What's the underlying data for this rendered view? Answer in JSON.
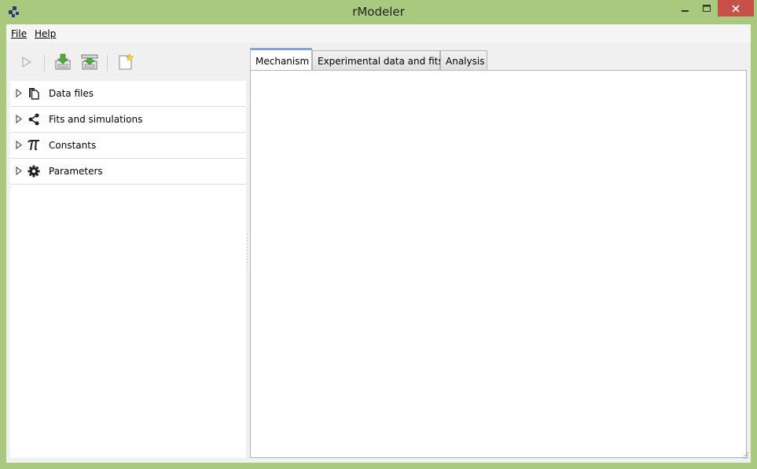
{
  "window": {
    "title": "rModeler",
    "frame_color": "#a8c97e",
    "close_color": "#c7504a"
  },
  "menu": {
    "file": "File",
    "help": "Help"
  },
  "toolbar": {
    "buttons": [
      {
        "icon": "play-icon",
        "enabled": false
      },
      {
        "icon": "import-green-icon",
        "enabled": true
      },
      {
        "icon": "export-green-icon",
        "enabled": true
      },
      {
        "icon": "new-document-icon",
        "enabled": true
      }
    ]
  },
  "tree": {
    "items": [
      {
        "label": "Data files",
        "icon": "copy-files-icon"
      },
      {
        "label": "Fits and simulations",
        "icon": "share-nodes-icon"
      },
      {
        "label": "Constants",
        "icon": "pi-icon"
      },
      {
        "label": "Parameters",
        "icon": "gear-icon"
      }
    ]
  },
  "tabs": {
    "items": [
      {
        "label": "Mechanism"
      },
      {
        "label": "Experimental data and fits"
      },
      {
        "label": "Analysis"
      }
    ],
    "active_color": "#7fa6d6"
  }
}
